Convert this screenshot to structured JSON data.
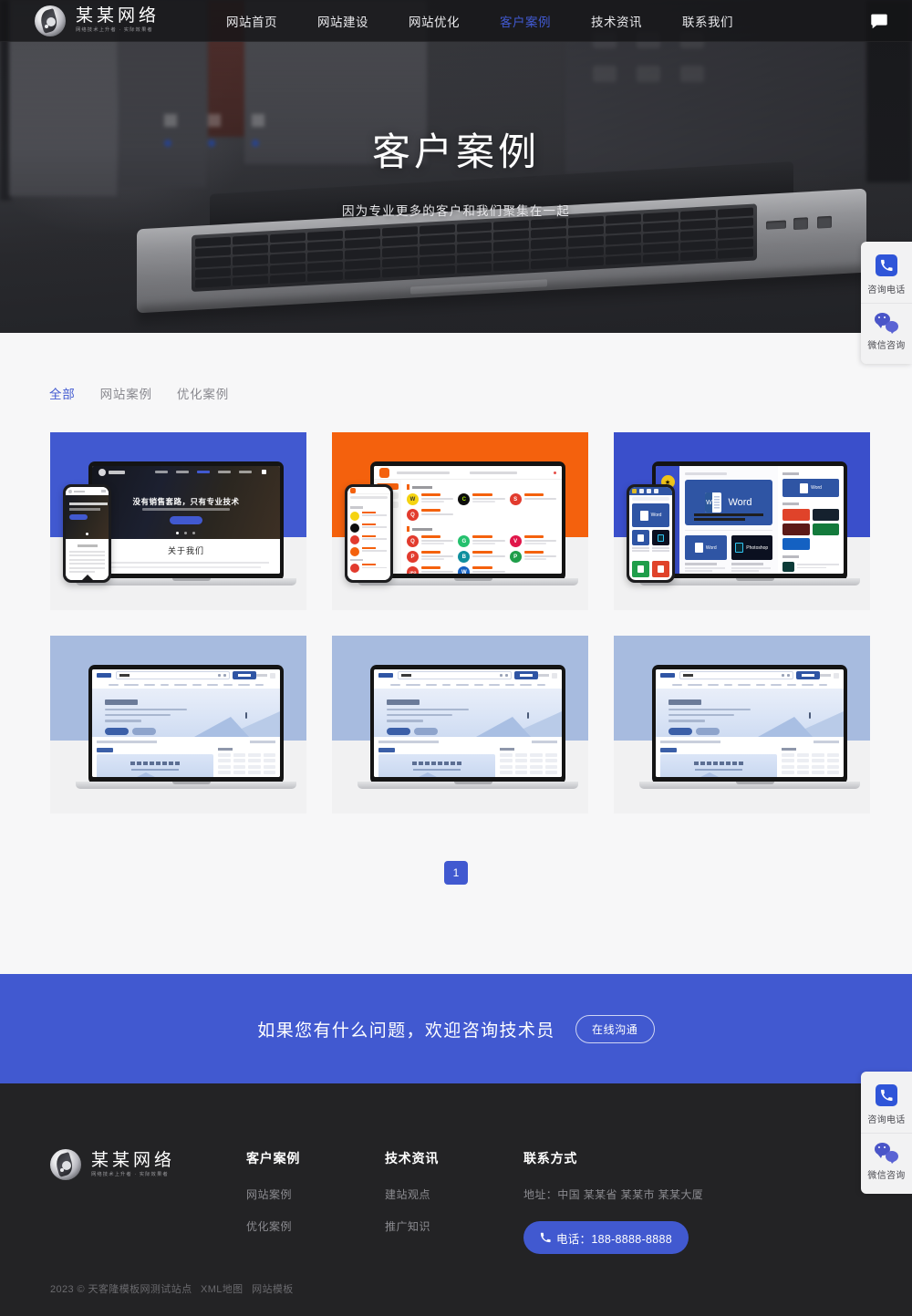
{
  "header": {
    "logo": {
      "name": "某某网络",
      "tagline": "网络技术上升者 · 实际效果者",
      "icon": "flame-circle-logo-icon"
    },
    "nav": [
      {
        "label": "网站首页",
        "active": false
      },
      {
        "label": "网站建设",
        "active": false
      },
      {
        "label": "网站优化",
        "active": false
      },
      {
        "label": "客户案例",
        "active": true
      },
      {
        "label": "技术资讯",
        "active": false
      },
      {
        "label": "联系我们",
        "active": false
      }
    ],
    "chat_icon": "chat-bubble-icon",
    "active_color": "#4159d0"
  },
  "hero": {
    "title": "客户案例",
    "subtitle": "因为专业更多的客户和我们聚集在一起"
  },
  "filters": [
    {
      "label": "全部",
      "active": true
    },
    {
      "label": "网站案例",
      "active": false
    },
    {
      "label": "优化案例",
      "active": false
    }
  ],
  "cases": [
    {
      "variant": "v1",
      "accent": "#4159d0",
      "headline": "没有销售套路，只有专业技术",
      "section": "关于我们"
    },
    {
      "variant": "v2",
      "accent": "#f4610d",
      "headline": "",
      "section": ""
    },
    {
      "variant": "v3",
      "accent": "#3a4fcb",
      "headline": "Word",
      "section": ""
    },
    {
      "variant": "v4",
      "accent": "#a7bbdf",
      "headline": "",
      "section": ""
    },
    {
      "variant": "v5",
      "accent": "#a7bbdf",
      "headline": "",
      "section": ""
    },
    {
      "variant": "v6",
      "accent": "#a7bbdf",
      "headline": "",
      "section": ""
    }
  ],
  "pagination": {
    "current": "1"
  },
  "cta": {
    "text": "如果您有什么问题，欢迎咨询技术员",
    "button": "在线沟通",
    "background": "#4159d0"
  },
  "footer": {
    "logo": {
      "name": "某某网络",
      "tagline": "网络技术上升者 · 实际效果者"
    },
    "columns": [
      {
        "title": "客户案例",
        "links": [
          "网站案例",
          "优化案例"
        ]
      },
      {
        "title": "技术资讯",
        "links": [
          "建站观点",
          "推广知识"
        ]
      }
    ],
    "contact": {
      "title": "联系方式",
      "address": "地址：中国 某某省 某某市 某某大厦",
      "phone": "电话：188-8888-8888",
      "phone_icon": "phone-icon"
    },
    "copyright": "2023 © 天客隆模板网测试站点",
    "links": [
      "XML地图",
      "网站模板"
    ]
  },
  "float_widget": {
    "items": [
      {
        "label": "咨询电话",
        "icon": "phone-icon"
      },
      {
        "label": "微信咨询",
        "icon": "wechat-icon"
      }
    ]
  }
}
